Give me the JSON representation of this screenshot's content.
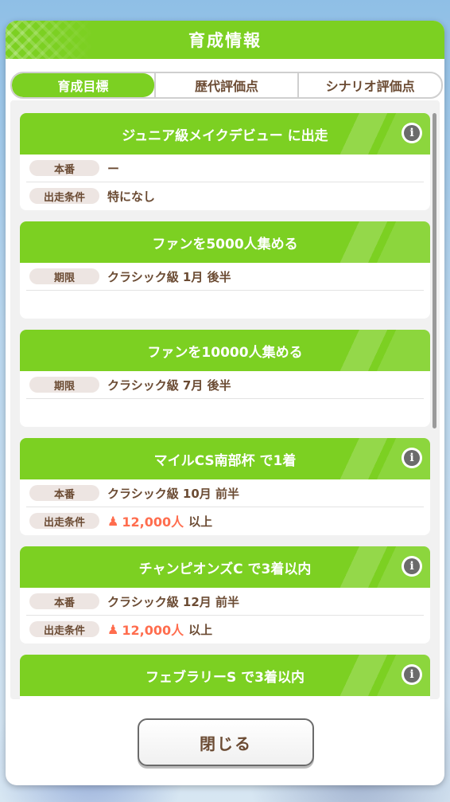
{
  "dialog": {
    "title": "育成情報"
  },
  "tabs": [
    {
      "label": "育成目標",
      "active": true
    },
    {
      "label": "歴代評価点",
      "active": false
    },
    {
      "label": "シナリオ評価点",
      "active": false
    }
  ],
  "cards": [
    {
      "title": "ジュニア級メイクデビュー に出走",
      "info": "i",
      "rows": [
        {
          "label": "本番",
          "value": "ー"
        },
        {
          "label": "出走条件",
          "value": "特になし"
        }
      ]
    },
    {
      "title": "ファンを5000人集める",
      "rows": [
        {
          "label": "期限",
          "value": "クラシック級 1月 後半"
        }
      ]
    },
    {
      "title": "ファンを10000人集める",
      "rows": [
        {
          "label": "期限",
          "value": "クラシック級 7月 後半"
        }
      ]
    },
    {
      "title": "マイルCS南部杯 で1着",
      "info": "i",
      "rows": [
        {
          "label": "本番",
          "value": "クラシック級 10月 前半"
        },
        {
          "label": "出走条件",
          "fans": "12,000人",
          "suffix": "以上"
        }
      ]
    },
    {
      "title": "チャンピオンズC で3着以内",
      "info": "i",
      "rows": [
        {
          "label": "本番",
          "value": "クラシック級 12月 前半"
        },
        {
          "label": "出走条件",
          "fans": "12,000人",
          "suffix": "以上"
        }
      ]
    },
    {
      "title": "フェブラリーS で3着以内",
      "info": "i",
      "rows": []
    }
  ],
  "close_button": {
    "label": "閉じる"
  },
  "colors": {
    "accent_green": "#7cd022",
    "text_brown": "#6b4b33",
    "fan_orange": "#ff6d4e"
  }
}
